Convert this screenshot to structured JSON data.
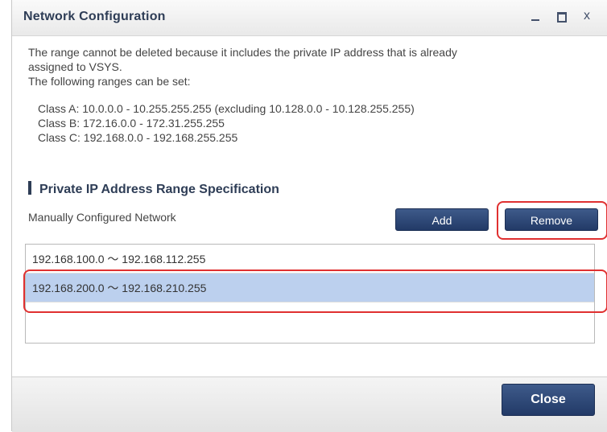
{
  "window": {
    "title": "Network Configuration",
    "controls": {
      "minimize": "minimize-icon",
      "maximize": "maximize-icon",
      "close_glyph": "x"
    }
  },
  "message": {
    "line1": "The range cannot be deleted because it includes the private IP address that is already",
    "line2": "assigned to VSYS.",
    "line3": "The following ranges can be set:"
  },
  "ranges": [
    "Class A: 10.0.0.0 - 10.255.255.255 (excluding 10.128.0.0 - 10.128.255.255)",
    "Class B: 172.16.0.0 - 172.31.255.255",
    "Class C: 192.168.0.0 - 192.168.255.255"
  ],
  "section": {
    "title": "Private IP Address Range Specification",
    "manual_label": "Manually Configured Network",
    "add_label": "Add",
    "remove_label": "Remove"
  },
  "network_list": [
    {
      "text": "192.168.100.0 ～ 192.168.112.255",
      "selected": false
    },
    {
      "text": "192.168.200.0 ～ 192.168.210.255",
      "selected": true
    }
  ],
  "footer": {
    "close_label": "Close"
  },
  "colors": {
    "button_blue": "#2c4678",
    "selected_row": "#bcd0ee",
    "highlight_red": "#e03030",
    "title_text": "#2e3d56"
  }
}
